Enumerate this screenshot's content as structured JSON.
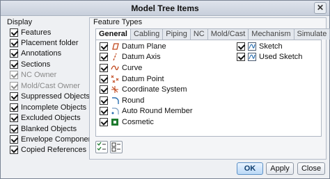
{
  "title": "Model Tree Items",
  "display": {
    "label": "Display",
    "items": [
      {
        "label": "Features",
        "checked": true,
        "enabled": true
      },
      {
        "label": "Placement folder",
        "checked": true,
        "enabled": true
      },
      {
        "label": "Annotations",
        "checked": true,
        "enabled": true
      },
      {
        "label": "Sections",
        "checked": true,
        "enabled": true
      },
      {
        "label": "NC Owner",
        "checked": true,
        "enabled": false
      },
      {
        "label": "Mold/Cast Owner",
        "checked": true,
        "enabled": false
      },
      {
        "label": "Suppressed Objects",
        "checked": true,
        "enabled": true
      },
      {
        "label": "Incomplete Objects",
        "checked": true,
        "enabled": true
      },
      {
        "label": "Excluded Objects",
        "checked": true,
        "enabled": true
      },
      {
        "label": "Blanked Objects",
        "checked": true,
        "enabled": true
      },
      {
        "label": "Envelope Components",
        "checked": true,
        "enabled": true
      },
      {
        "label": "Copied References",
        "checked": true,
        "enabled": true
      }
    ]
  },
  "feature_types": {
    "label": "Feature Types",
    "tabs": [
      "General",
      "Cabling",
      "Piping",
      "NC",
      "Mold/Cast",
      "Mechanism",
      "Simulate"
    ],
    "active_tab": "General",
    "left_items": [
      {
        "label": "Datum Plane",
        "icon": "datum-plane-icon"
      },
      {
        "label": "Datum Axis",
        "icon": "datum-axis-icon"
      },
      {
        "label": "Curve",
        "icon": "curve-icon"
      },
      {
        "label": "Datum Point",
        "icon": "datum-point-icon"
      },
      {
        "label": "Coordinate System",
        "icon": "coordinate-system-icon"
      },
      {
        "label": "Round",
        "icon": "round-icon"
      },
      {
        "label": "Auto Round Member",
        "icon": "auto-round-icon"
      },
      {
        "label": "Cosmetic",
        "icon": "cosmetic-icon"
      }
    ],
    "right_items": [
      {
        "label": "Sketch",
        "icon": "sketch-icon"
      },
      {
        "label": "Used Sketch",
        "icon": "used-sketch-icon"
      }
    ]
  },
  "buttons": {
    "ok": "OK",
    "apply": "Apply",
    "close": "Close"
  },
  "colors": {
    "accent": "#5b8fc4",
    "orange": "#c0461b",
    "green": "#1e7a2e"
  }
}
